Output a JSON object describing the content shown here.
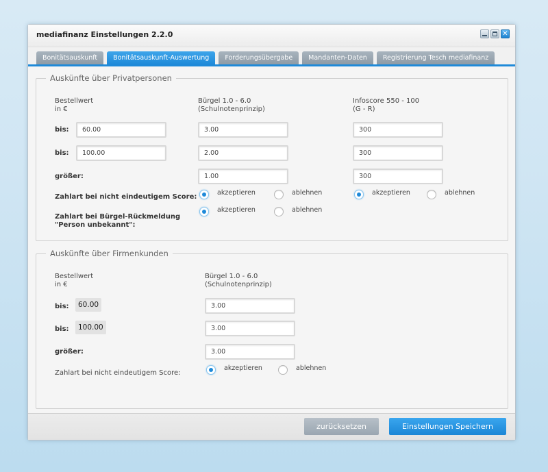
{
  "window": {
    "title": "mediafinanz Einstellungen 2.2.0"
  },
  "tabs": [
    {
      "label": "Bonitätsauskunft"
    },
    {
      "label": "Bonitätsauskunft-Auswertung"
    },
    {
      "label": "Forderungsübergabe"
    },
    {
      "label": "Mandanten-Daten"
    },
    {
      "label": "Registrierung Tesch mediafinanz"
    }
  ],
  "private": {
    "legend": "Auskünfte über Privatpersonen",
    "col1_header_1": "Bestellwert",
    "col1_header_2": "in €",
    "col2_header_1": "Bürgel 1.0 - 6.0",
    "col2_header_2": "(Schulnotenprinzip)",
    "col3_header_1": "Infoscore 550 - 100",
    "col3_header_2": "(G - R)",
    "row1_label": "bis:",
    "row1_value": "60.00",
    "row1_buergel": "3.00",
    "row1_infoscore": "300",
    "row2_label": "bis:",
    "row2_value": "100.00",
    "row2_buergel": "2.00",
    "row2_infoscore": "300",
    "row3_label": "größer:",
    "row3_buergel": "1.00",
    "row3_infoscore": "300",
    "score_label": "Zahlart bei nicht eindeutigem Score:",
    "unknown_label_1": "Zahlart bei Bürgel-Rückmeldung",
    "unknown_label_2": "\"Person unbekannt\":",
    "accept": "akzeptieren",
    "reject": "ablehnen"
  },
  "business": {
    "legend": "Auskünfte über Firmenkunden",
    "col1_header_1": "Bestellwert",
    "col1_header_2": "in €",
    "col2_header_1": "Bürgel 1.0 - 6.0",
    "col2_header_2": "(Schulnotenprinzip)",
    "row1_label": "bis:",
    "row1_value": "60.00",
    "row1_buergel": "3.00",
    "row2_label": "bis:",
    "row2_value": "100.00",
    "row2_buergel": "3.00",
    "row3_label": "größer:",
    "row3_buergel": "3.00",
    "score_label": "Zahlart bei nicht eindeutigem Score:",
    "accept": "akzeptieren",
    "reject": "ablehnen"
  },
  "footer": {
    "reset_label": "zurücksetzen",
    "save_label": "Einstellungen Speichern"
  },
  "colors": {
    "accent": "#1f8ad9",
    "tab_inactive": "#9aa6b1"
  }
}
